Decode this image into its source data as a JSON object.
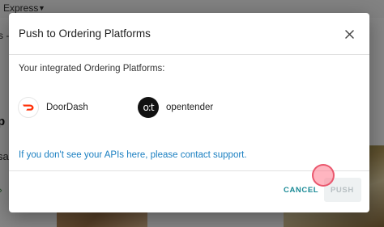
{
  "background": {
    "express_label": "Express",
    "left_text_1": "s -",
    "left_text_2": "p",
    "left_text_3": "sa",
    "left_text_4": "›"
  },
  "dialog": {
    "title": "Push to Ordering Platforms",
    "close_icon": "close-icon",
    "subtitle": "Your integrated Ordering Platforms:",
    "platforms": [
      {
        "name": "DoorDash",
        "logo": "doordash-logo"
      },
      {
        "name": "opentender",
        "logo": "opentender-logo",
        "logo_text": "o:t"
      }
    ],
    "support_text": "If you don't see your APIs here, please contact support.",
    "cancel_label": "CANCEL",
    "push_label": "PUSH"
  },
  "colors": {
    "link": "#1a7fc1",
    "cancel": "#1a8a96",
    "doordash_red": "#ff3008",
    "push_disabled_text": "#b8c0c3"
  }
}
